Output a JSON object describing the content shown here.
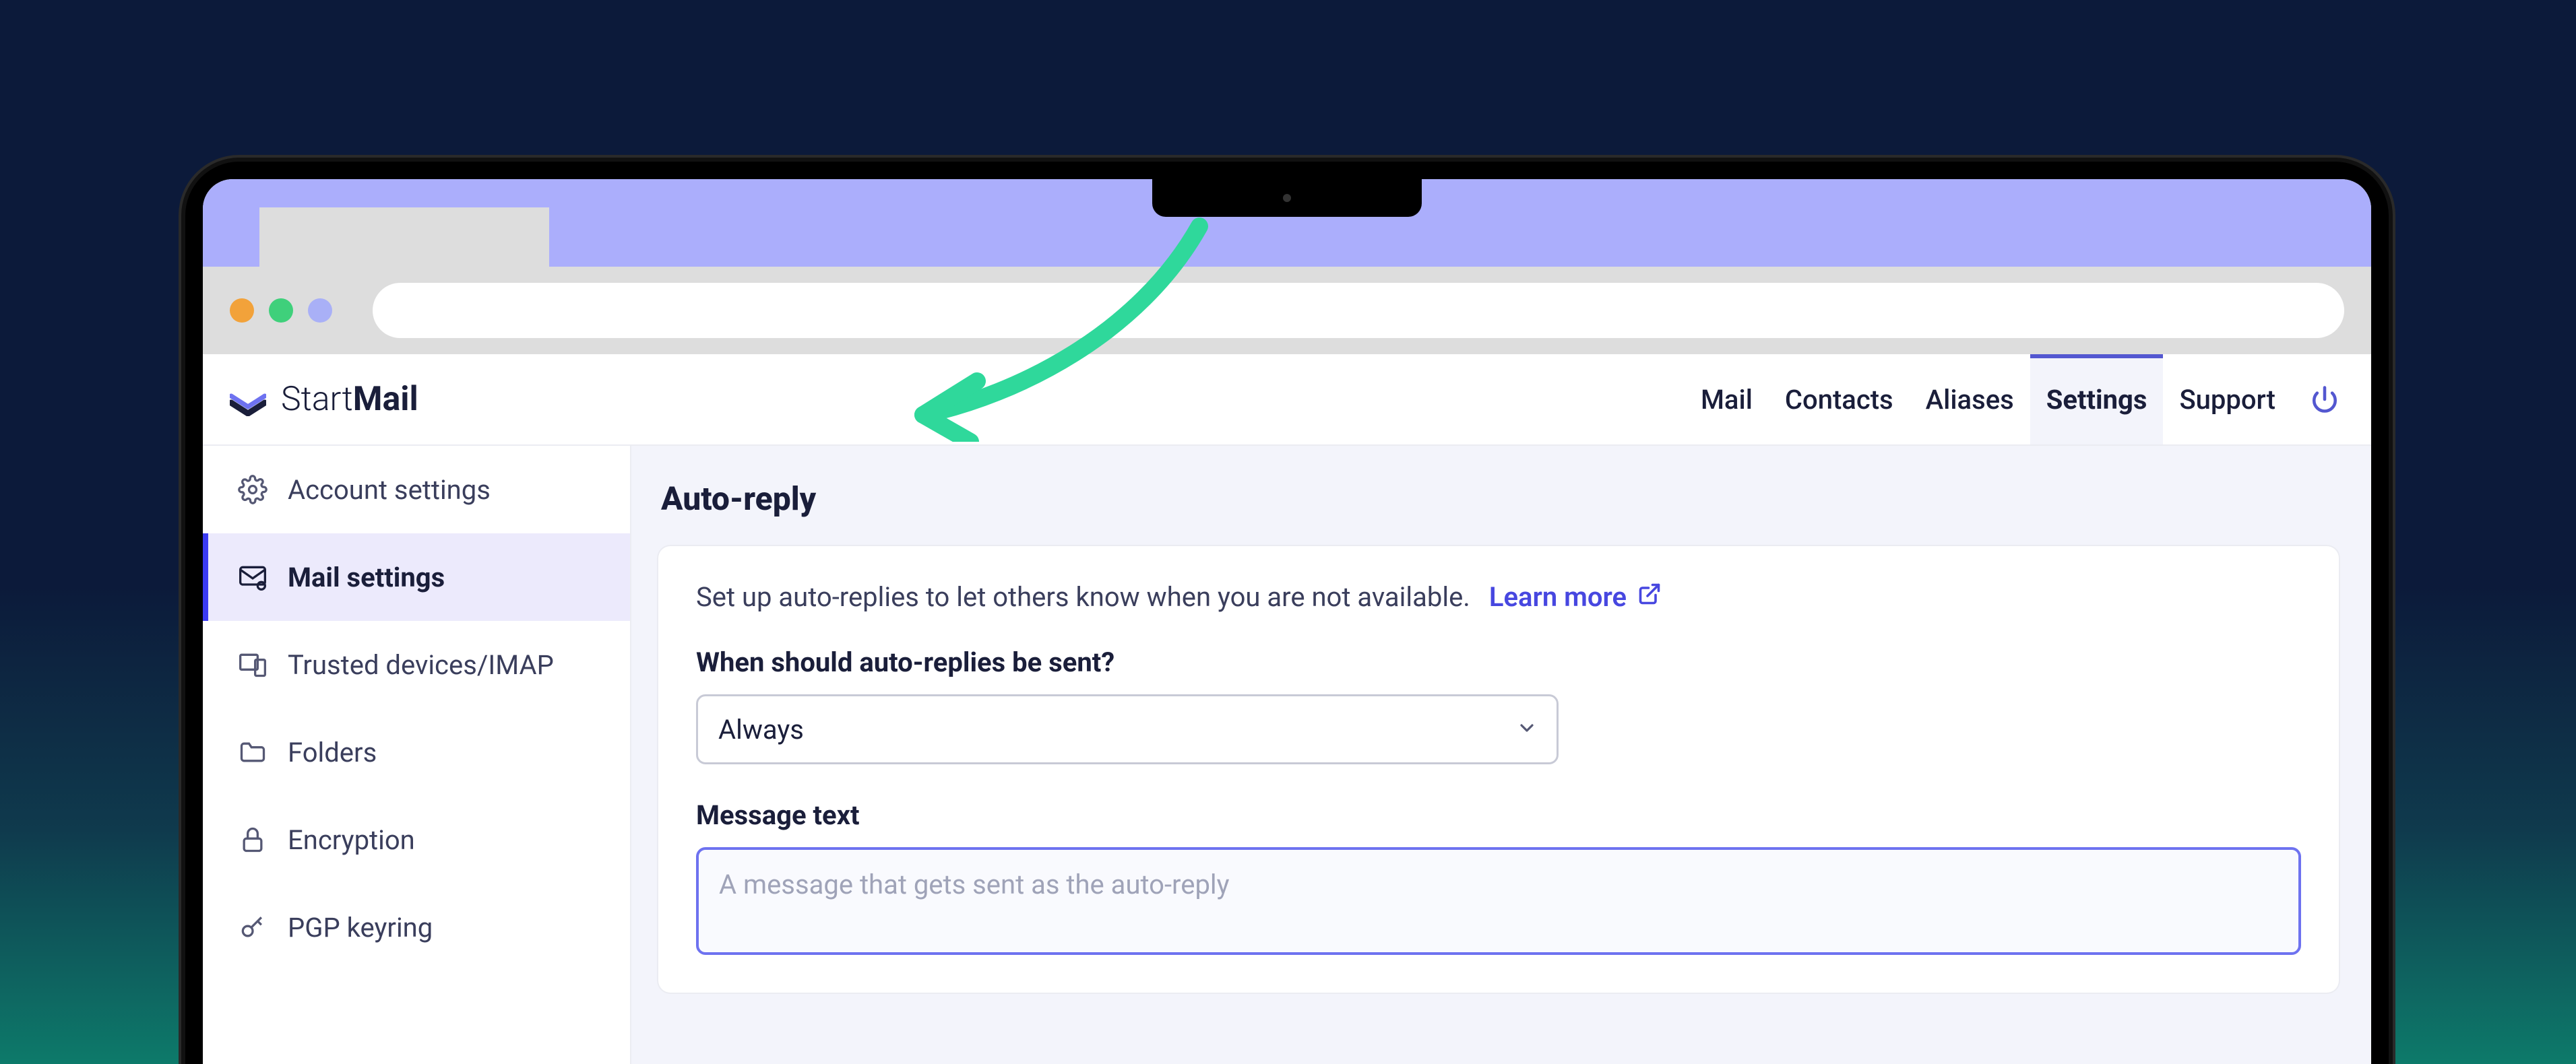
{
  "brand": {
    "start": "Start",
    "mail": "Mail"
  },
  "nav": {
    "items": [
      {
        "label": "Mail"
      },
      {
        "label": "Contacts"
      },
      {
        "label": "Aliases"
      },
      {
        "label": "Settings",
        "active": true
      },
      {
        "label": "Support"
      }
    ]
  },
  "sidebar": {
    "items": [
      {
        "label": "Account settings"
      },
      {
        "label": "Mail settings",
        "active": true
      },
      {
        "label": "Trusted devices/IMAP"
      },
      {
        "label": "Folders"
      },
      {
        "label": "Encryption"
      },
      {
        "label": "PGP keyring"
      }
    ]
  },
  "page": {
    "title": "Auto-reply",
    "desc": "Set up auto-replies to let others know when you are not available.",
    "learn_more": "Learn more",
    "when_label": "When should auto-replies be sent?",
    "when_value": "Always",
    "msg_label": "Message text",
    "msg_placeholder": "A message that gets sent as the auto-reply"
  },
  "colors": {
    "accent": "#4747e0",
    "arrow": "#2fd89b"
  }
}
